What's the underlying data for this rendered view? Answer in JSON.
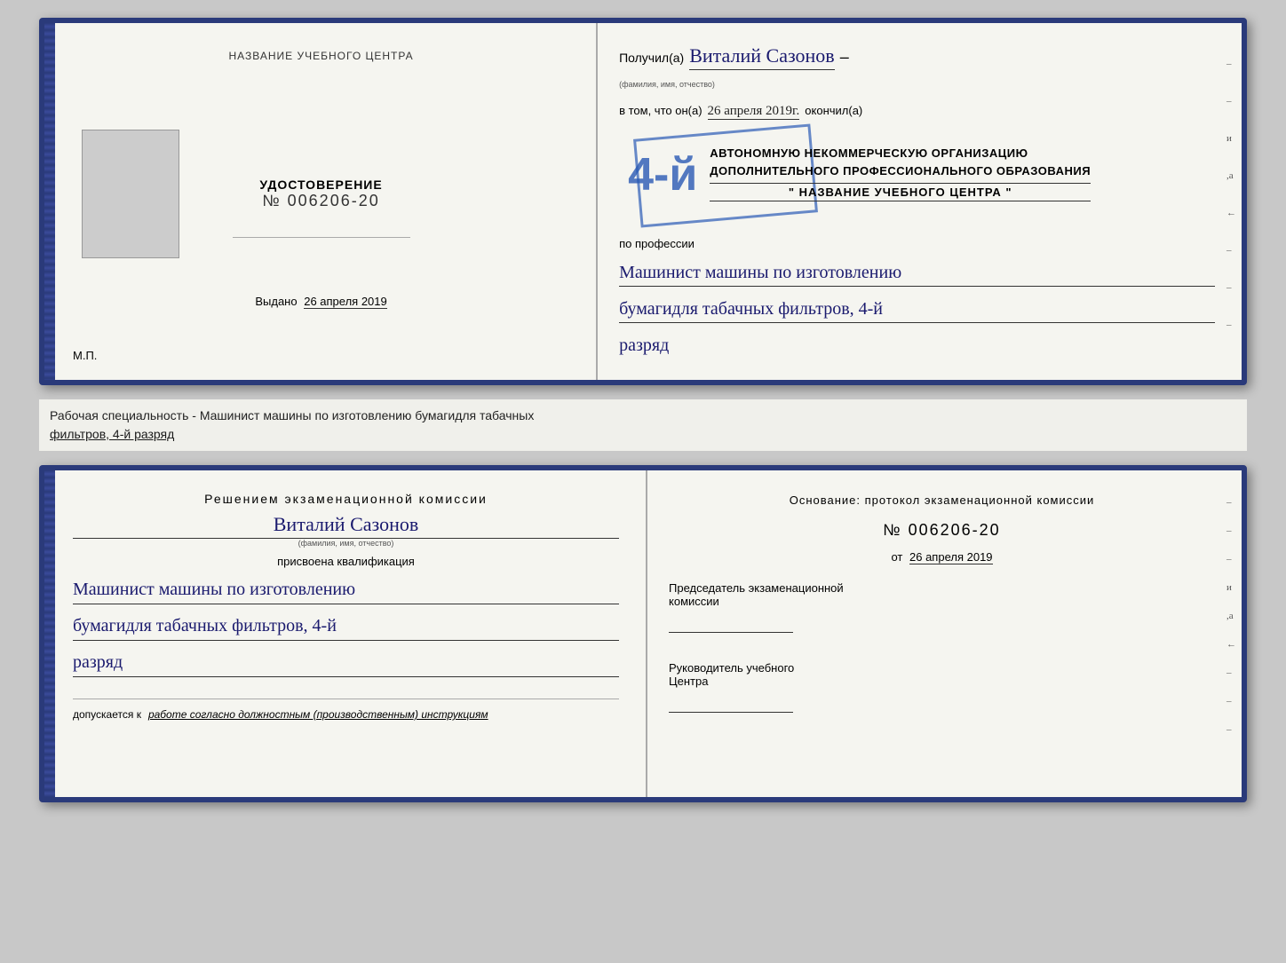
{
  "top_cert": {
    "left": {
      "training_center_label": "НАЗВАНИЕ УЧЕБНОГО ЦЕНТРА",
      "udostoverenie": "УДОСТОВЕРЕНИЕ",
      "number": "№ 006206-20",
      "vydano_label": "Выдано",
      "vydano_date": "26 апреля 2019",
      "mp": "М.П."
    },
    "right": {
      "poluchil_prefix": "Получил(а)",
      "recipient_name": "Виталий Сазонов",
      "fio_label": "(фамилия, имя, отчество)",
      "dash": "–",
      "vtom_prefix": "в том, что он(а)",
      "date_handwritten": "26 апреля 2019г.",
      "okonchil": "окончил(а)",
      "stamp_number": "4-й",
      "org_line1": "АВТОНОМНУЮ НЕКОММЕРЧЕСКУЮ ОРГАНИЗАЦИЮ",
      "org_line2": "ДОПОЛНИТЕЛЬНОГО ПРОФЕССИОНАЛЬНОГО ОБРАЗОВАНИЯ",
      "org_name": "\" НАЗВАНИЕ УЧЕБНОГО ЦЕНТРА \"",
      "poprofessii": "по профессии",
      "prof_line1": "Машинист машины по изготовлению",
      "prof_line2": "бумагидля табачных фильтров, 4-й",
      "prof_line3": "разряд",
      "side_marks": [
        "–",
        "–",
        "и",
        ",а",
        "←",
        "–",
        "–",
        "–"
      ]
    }
  },
  "middle_band": {
    "text": "Рабочая специальность - Машинист машины по изготовлению бумагидля табачных",
    "text2_underline": "фильтров, 4-й разряд"
  },
  "bottom_cert": {
    "left": {
      "resheniyem": "Решением  экзаменационной  комиссии",
      "name": "Виталий Сазонов",
      "fio_label": "(фамилия, имя, отчество)",
      "prisvoena": "присвоена квалификация",
      "qual_line1": "Машинист машины по изготовлению",
      "qual_line2": "бумагидля табачных фильтров, 4-й",
      "qual_line3": "разряд",
      "dopuskaetsya_prefix": "допускается к",
      "dopuskaetsya_text": "работе согласно должностным (производственным) инструкциям"
    },
    "right": {
      "osnovanie": "Основание:  протокол  экзаменационной  комиссии",
      "number": "№  006206-20",
      "ot_prefix": "от",
      "ot_date": "26 апреля 2019",
      "predsedatel_line1": "Председатель экзаменационной",
      "predsedatel_line2": "комиссии",
      "rukovoditel_line1": "Руководитель учебного",
      "rukovoditel_line2": "Центра",
      "side_marks": [
        "–",
        "–",
        "–",
        "и",
        ",а",
        "←",
        "–",
        "–",
        "–"
      ]
    }
  }
}
